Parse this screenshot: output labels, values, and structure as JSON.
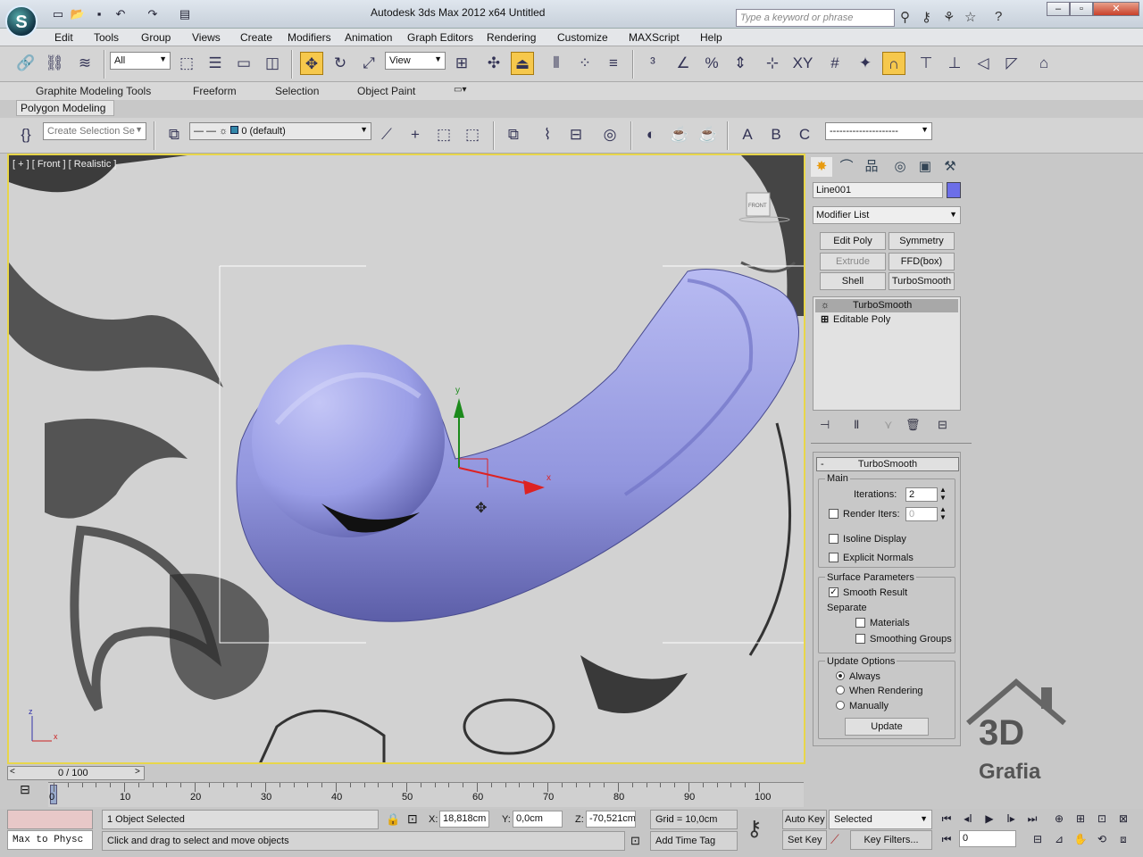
{
  "window": {
    "title": "Autodesk 3ds Max  2012 x64      Untitled",
    "search_placeholder": "Type a keyword or phrase"
  },
  "menu": [
    "Edit",
    "Tools",
    "Group",
    "Views",
    "Create",
    "Modifiers",
    "Animation",
    "Graph Editors",
    "Rendering",
    "Customize",
    "MAXScript",
    "Help"
  ],
  "toolbar": {
    "filter": "All",
    "coord": "View"
  },
  "ribbon": {
    "tabs": [
      "Graphite Modeling Tools",
      "Freeform",
      "Selection",
      "Object Paint"
    ],
    "sub": "Polygon Modeling"
  },
  "toolbar2": {
    "named_selection": "Create Selection Se",
    "layer": "0 (default)",
    "sets_dd": "---------------------"
  },
  "viewport": {
    "label": "[ + ] [ Front ] [ Realistic ]",
    "viewcube": "FRONT",
    "gizmo_x": "x",
    "gizmo_y": "y",
    "axis_z": "z",
    "axis_x": "x"
  },
  "panel": {
    "object_name": "Line001",
    "modifier_list": "Modifier List",
    "buttons": [
      "Edit Poly",
      "Symmetry",
      "Extrude",
      "FFD(box)",
      "Shell",
      "TurboSmooth"
    ],
    "stack": [
      "TurboSmooth",
      "Editable Poly"
    ],
    "rollout_title": "TurboSmooth",
    "main": {
      "title": "Main",
      "iterations_label": "Iterations:",
      "iterations": "2",
      "render_iters_label": "Render Iters:",
      "render_iters": "0",
      "isoline": "Isoline Display",
      "explicit": "Explicit Normals"
    },
    "surface": {
      "title": "Surface Parameters",
      "smooth_result": "Smooth Result",
      "separate": "Separate",
      "materials": "Materials",
      "smoothing_groups": "Smoothing Groups"
    },
    "update": {
      "title": "Update Options",
      "always": "Always",
      "when_rendering": "When Rendering",
      "manually": "Manually",
      "button": "Update"
    }
  },
  "timeline": {
    "frame": "0 / 100",
    "ticks": [
      "0",
      "10",
      "20",
      "30",
      "40",
      "50",
      "60",
      "70",
      "80",
      "90",
      "100"
    ]
  },
  "status": {
    "script": "Max to Physc",
    "selected": "1 Object Selected",
    "prompt": "Click and drag to select and move objects",
    "x_label": "X:",
    "x": "18,818cm",
    "y_label": "Y:",
    "y": "0,0cm",
    "z_label": "Z:",
    "z": "-70,521cm",
    "grid": "Grid = 10,0cm",
    "add_time_tag": "Add Time Tag",
    "auto_key": "Auto Key",
    "set_key": "Set Key",
    "key_mode": "Selected",
    "key_filters": "Key Filters...",
    "frame_field": "0"
  },
  "watermark": "3D Grafia"
}
